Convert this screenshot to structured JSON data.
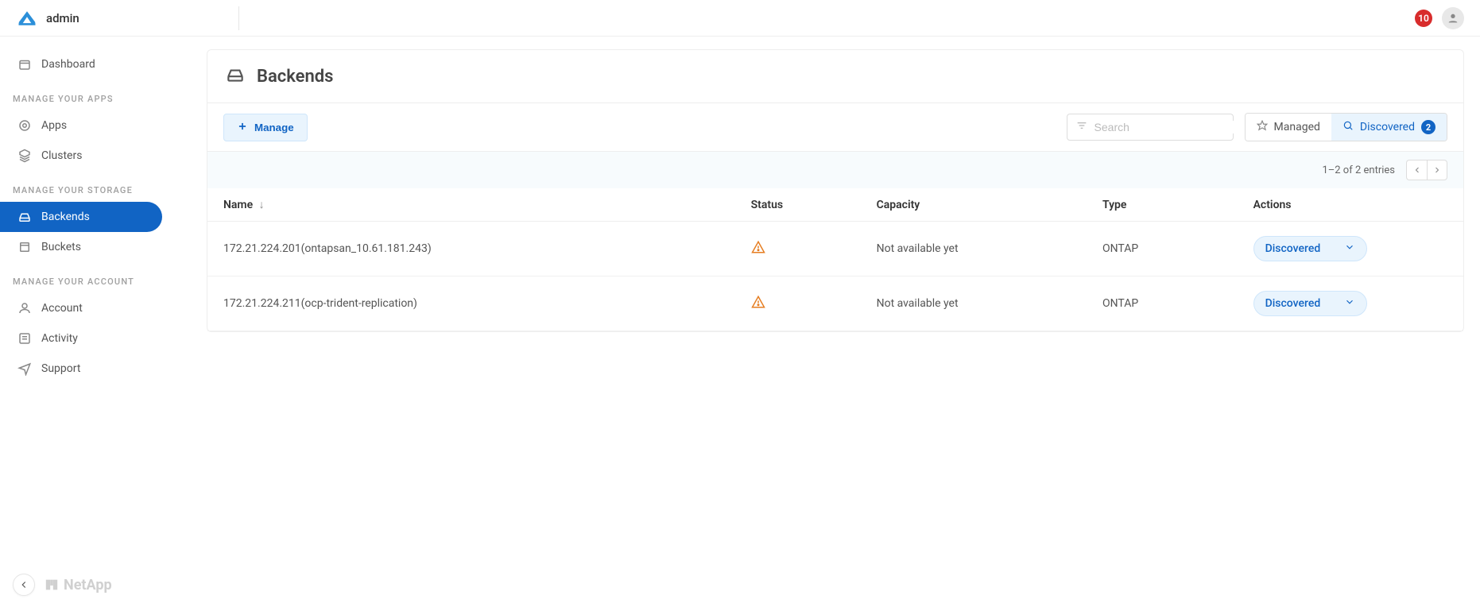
{
  "header": {
    "user": "admin",
    "notifications": "10"
  },
  "sidebar": {
    "sections": [
      {
        "label": "",
        "items": [
          {
            "id": "dashboard",
            "label": "Dashboard"
          }
        ]
      },
      {
        "label": "MANAGE YOUR APPS",
        "items": [
          {
            "id": "apps",
            "label": "Apps"
          },
          {
            "id": "clusters",
            "label": "Clusters"
          }
        ]
      },
      {
        "label": "MANAGE YOUR STORAGE",
        "items": [
          {
            "id": "backends",
            "label": "Backends",
            "active": true
          },
          {
            "id": "buckets",
            "label": "Buckets"
          }
        ]
      },
      {
        "label": "MANAGE YOUR ACCOUNT",
        "items": [
          {
            "id": "account",
            "label": "Account"
          },
          {
            "id": "activity",
            "label": "Activity"
          },
          {
            "id": "support",
            "label": "Support"
          }
        ]
      }
    ],
    "vendor": "NetApp"
  },
  "page": {
    "title": "Backends",
    "manage_btn": "Manage",
    "search_placeholder": "Search",
    "seg_managed": "Managed",
    "seg_discovered": "Discovered",
    "discovered_count": "2",
    "pagination_text": "1–2 of 2 entries",
    "columns": {
      "name": "Name",
      "status": "Status",
      "capacity": "Capacity",
      "type": "Type",
      "actions": "Actions"
    },
    "rows": [
      {
        "name": "172.21.224.201(ontapsan_10.61.181.243)",
        "status": "warning",
        "capacity": "Not available yet",
        "type": "ONTAP",
        "action": "Discovered"
      },
      {
        "name": "172.21.224.211(ocp-trident-replication)",
        "status": "warning",
        "capacity": "Not available yet",
        "type": "ONTAP",
        "action": "Discovered"
      }
    ]
  }
}
